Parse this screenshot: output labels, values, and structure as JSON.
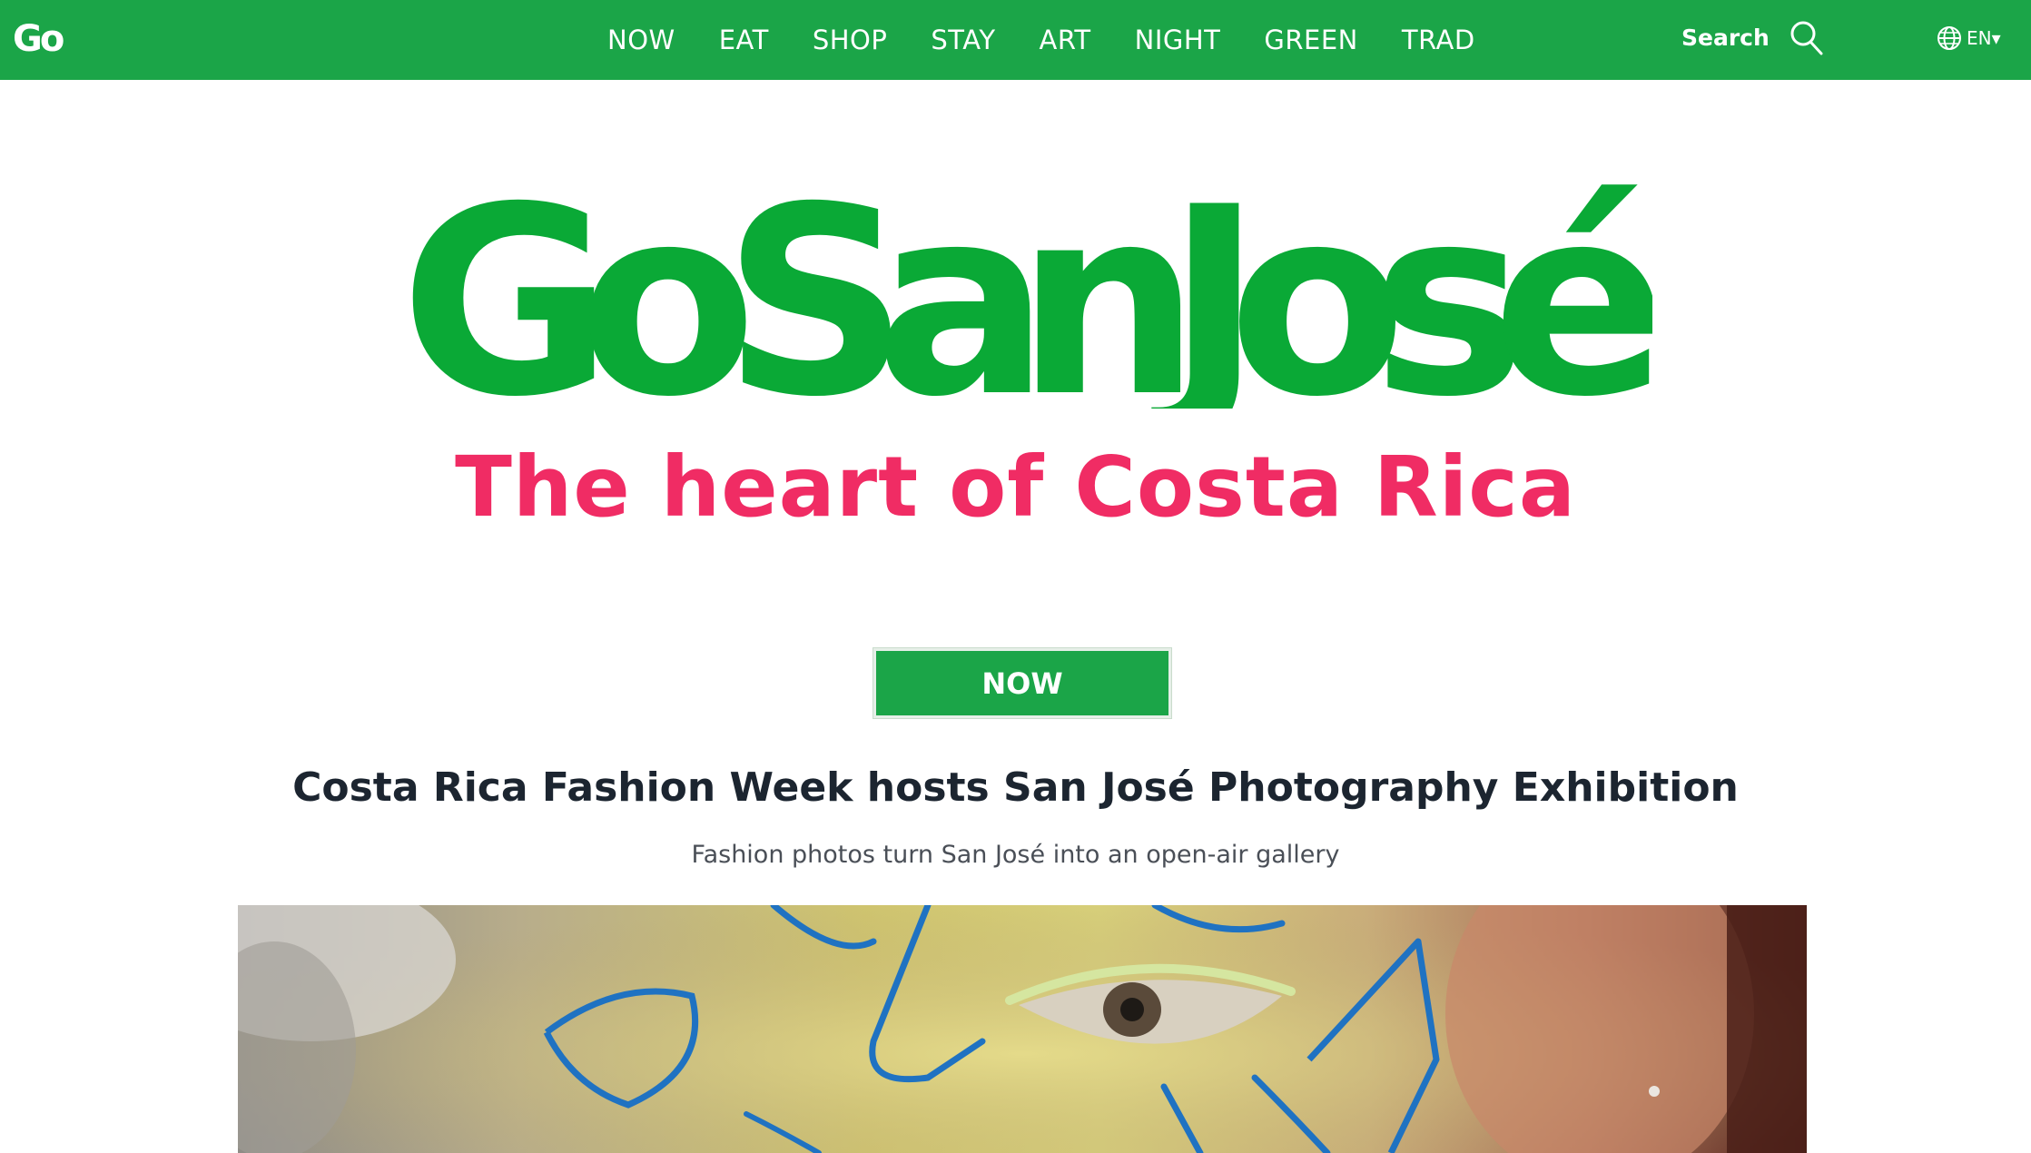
{
  "header": {
    "brand": "Go",
    "nav": [
      "NOW",
      "EAT",
      "SHOP",
      "STAY",
      "ART",
      "NIGHT",
      "GREEN",
      "TRAD"
    ],
    "search_label": "Search",
    "language": "EN▾"
  },
  "hero": {
    "logo_text": "GoSanJosé",
    "tagline": "The heart of Costa Rica"
  },
  "article": {
    "section_badge": "NOW",
    "title": "Costa Rica Fashion Week hosts San José Photography Exhibition",
    "subtitle": "Fashion photos turn San José into an open-air  gallery"
  },
  "colors": {
    "brand_green": "#1ba548",
    "accent_pink": "#f02c64",
    "headline_dark": "#1c2530"
  },
  "icons": [
    "search-icon",
    "globe-icon"
  ]
}
